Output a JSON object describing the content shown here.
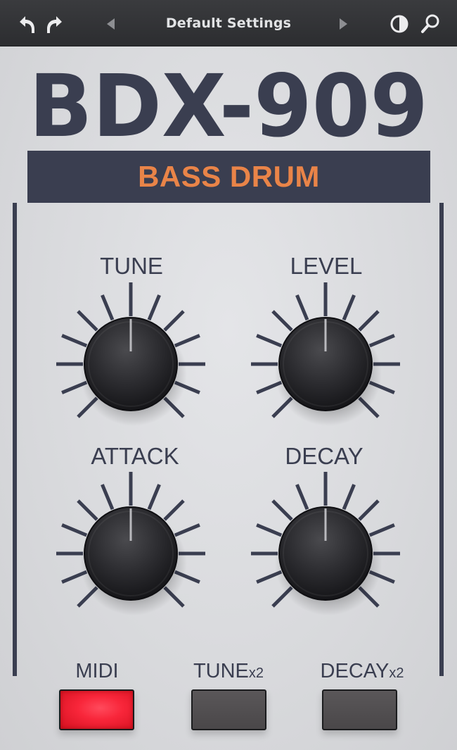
{
  "toolbar": {
    "preset_name": "Default Settings",
    "undo_icon": "undo-icon",
    "redo_icon": "redo-icon",
    "prev_icon": "triangle-left-icon",
    "next_icon": "triangle-right-icon",
    "compare_icon": "half-circle-icon",
    "search_icon": "magnifier-icon"
  },
  "plugin": {
    "logo_text": "BDX-909",
    "instrument": "BASS DRUM",
    "colors": {
      "navy": "#3a3e50",
      "orange": "#e98448",
      "led_red": "#f8263a"
    }
  },
  "knobs": [
    {
      "label": "TUNE",
      "value": 0.5
    },
    {
      "label": "LEVEL",
      "value": 0.5
    },
    {
      "label": "ATTACK",
      "value": 0.5
    },
    {
      "label": "DECAY",
      "value": 0.5
    }
  ],
  "switches": [
    {
      "label": "MIDI",
      "suffix": "",
      "on": true
    },
    {
      "label": "TUNE",
      "suffix": "x2",
      "on": false
    },
    {
      "label": "DECAY",
      "suffix": "x2",
      "on": false
    }
  ]
}
